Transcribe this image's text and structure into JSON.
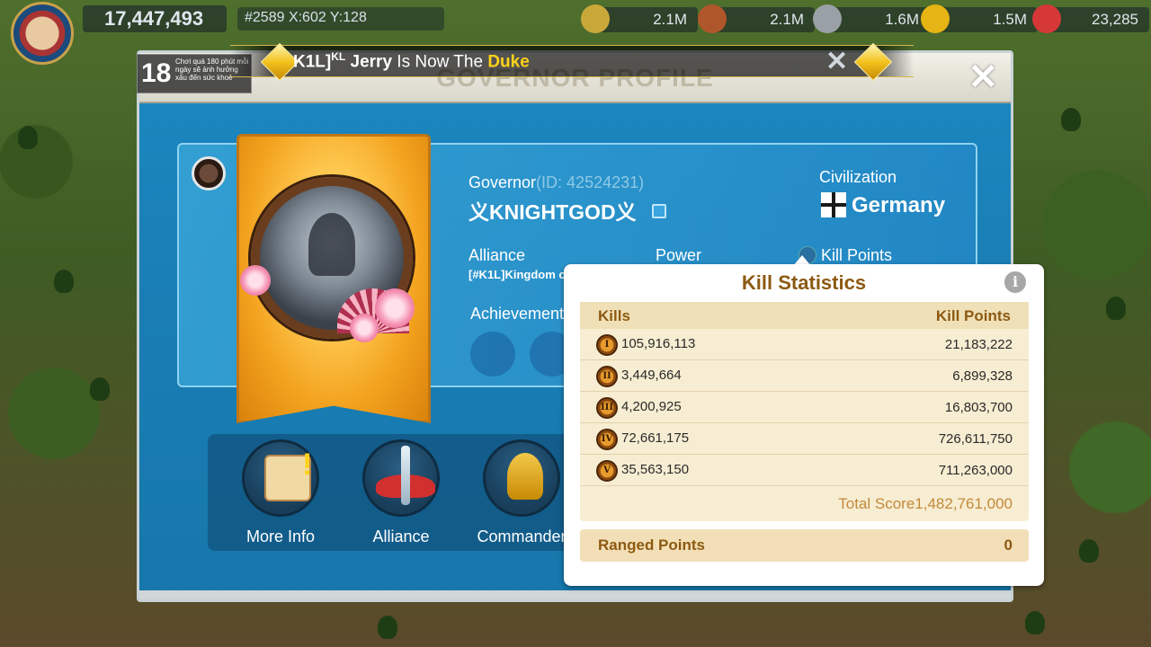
{
  "topbar": {
    "power": "17,447,493",
    "coords": "#2589 X:602 Y:128",
    "resources": [
      "2.1M",
      "2.1M",
      "1.6M",
      "1.5M",
      "23,285"
    ]
  },
  "marquee": {
    "tag": "K1L]",
    "tag_sup": "KL",
    "name": "Jerry",
    "middle": " Is Now The ",
    "title": "Duke",
    "close": "✕"
  },
  "age_notice": {
    "rating": "18",
    "text": "Chơi quá 180 phút mỗi ngày sẽ ảnh hưởng xấu đến sức khoẻ"
  },
  "modal": {
    "title": "GOVERNOR PROFILE",
    "close": "✕"
  },
  "profile": {
    "governor_label": "Governor",
    "governor_id": "(ID: 42524231)",
    "name": "义KNIGHTGOD义",
    "civ_label": "Civilization",
    "civ_name": "Germany",
    "alliance_label": "Alliance",
    "alliance_value": "[#K1L]Kingdom o",
    "power_label": "Power",
    "kp_label": "Kill Points",
    "achievement_label": "Achievement"
  },
  "buttons": [
    {
      "label": "More Info"
    },
    {
      "label": "Alliance"
    },
    {
      "label": "Commander"
    }
  ],
  "kill_stats": {
    "title": "Kill Statistics",
    "info": "i",
    "col_kills": "Kills",
    "col_points": "Kill Points",
    "rows": [
      {
        "tier": "I",
        "kills": "105,916,113",
        "points": "21,183,222"
      },
      {
        "tier": "II",
        "kills": "3,449,664",
        "points": "6,899,328"
      },
      {
        "tier": "III",
        "kills": "4,200,925",
        "points": "16,803,700"
      },
      {
        "tier": "IV",
        "kills": "72,661,175",
        "points": "726,611,750"
      },
      {
        "tier": "V",
        "kills": "35,563,150",
        "points": "711,263,000"
      }
    ],
    "total": "Total Score1,482,761,000",
    "ranged_label": "Ranged Points",
    "ranged_value": "0"
  }
}
